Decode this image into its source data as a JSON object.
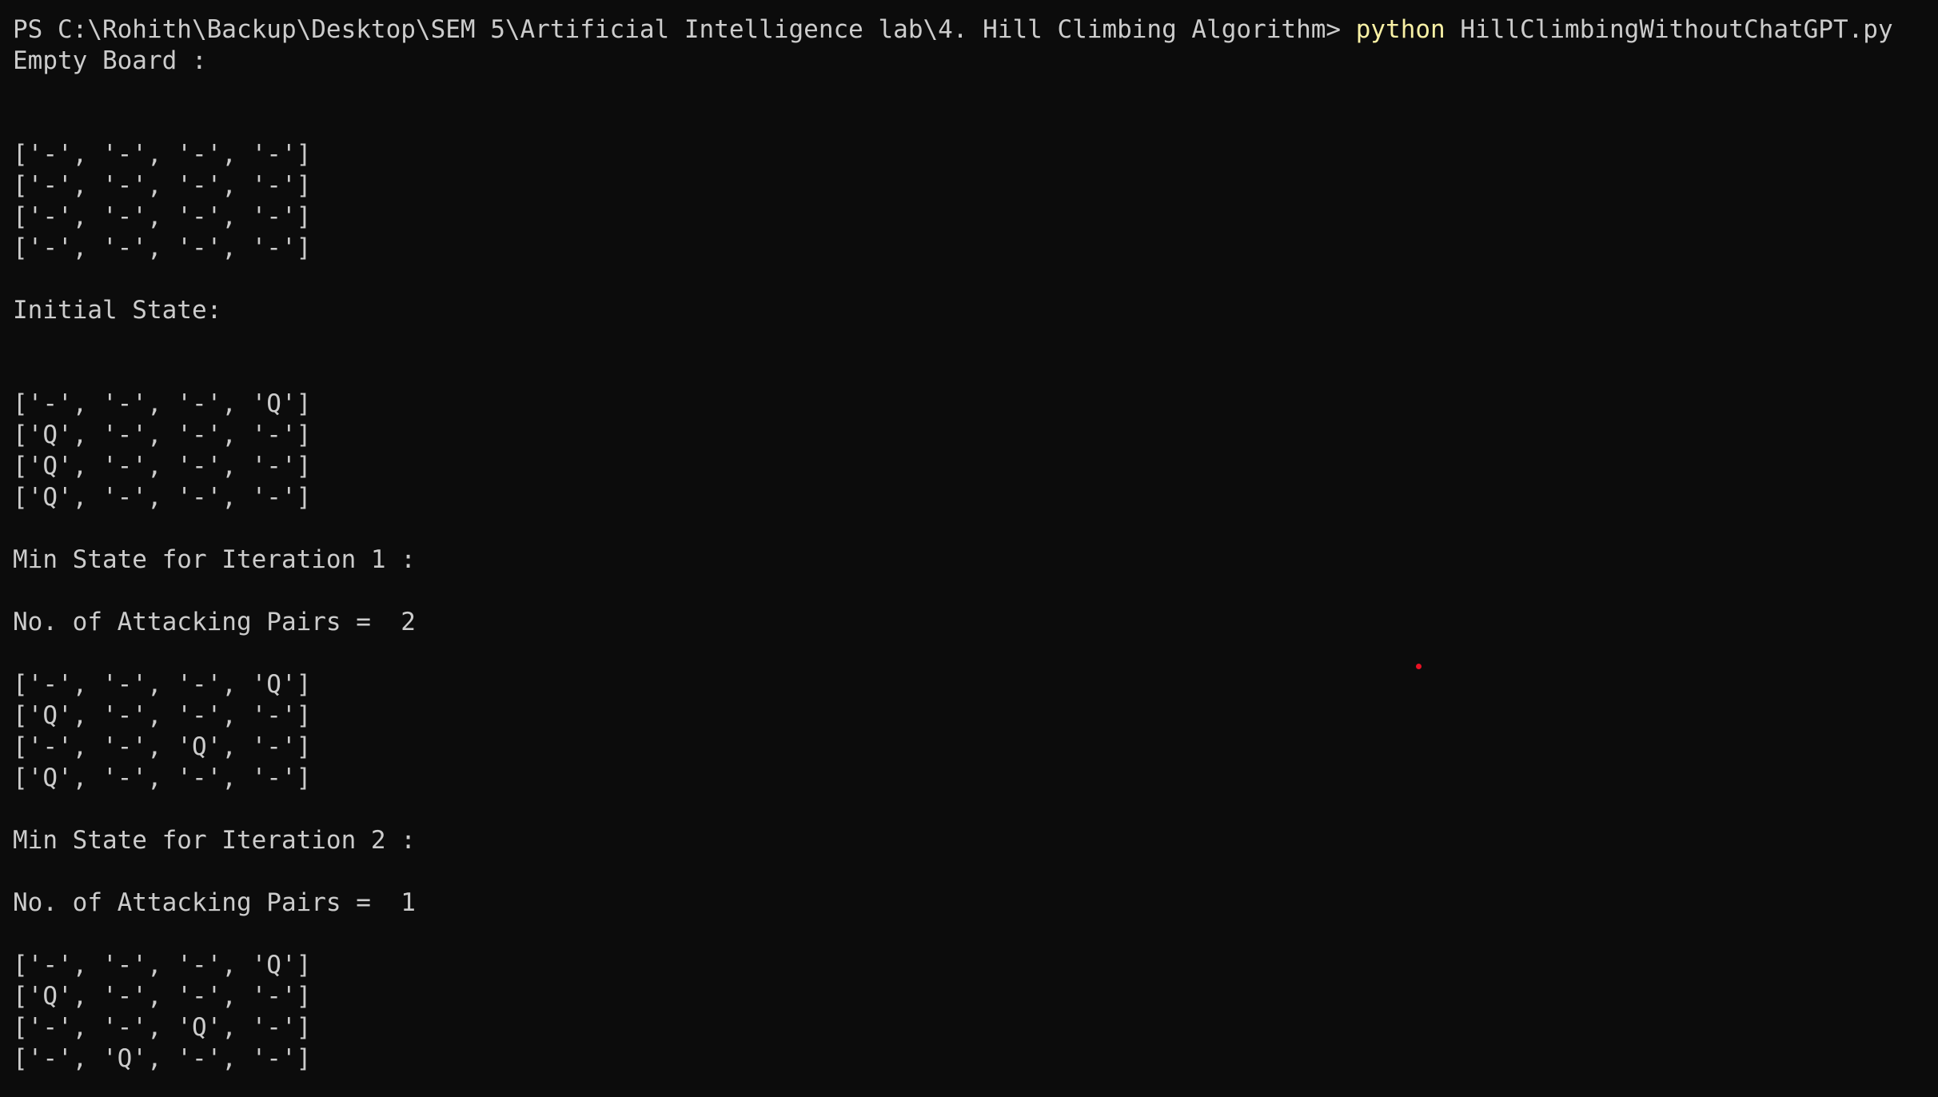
{
  "terminal": {
    "prompt": "PS C:\\Rohith\\Backup\\Desktop\\SEM 5\\Artificial Intelligence lab\\4. Hill Climbing Algorithm> ",
    "command_keyword": "python",
    "command_args": " HillClimbingWithoutChatGPT.py",
    "lines": [
      "Empty Board :",
      "",
      "",
      "['-', '-', '-', '-']",
      "['-', '-', '-', '-']",
      "['-', '-', '-', '-']",
      "['-', '-', '-', '-']",
      "",
      "Initial State:",
      "",
      "",
      "['-', '-', '-', 'Q']",
      "['Q', '-', '-', '-']",
      "['Q', '-', '-', '-']",
      "['Q', '-', '-', '-']",
      "",
      "Min State for Iteration 1 :",
      "",
      "No. of Attacking Pairs =  2",
      "",
      "['-', '-', '-', 'Q']",
      "['Q', '-', '-', '-']",
      "['-', '-', 'Q', '-']",
      "['Q', '-', '-', '-']",
      "",
      "Min State for Iteration 2 :",
      "",
      "No. of Attacking Pairs =  1",
      "",
      "['-', '-', '-', 'Q']",
      "['Q', '-', '-', '-']",
      "['-', '-', 'Q', '-']",
      "['-', 'Q', '-', '-']"
    ]
  },
  "colors": {
    "background": "#0c0c0c",
    "text": "#cccccc",
    "keyword": "#f9f1a5",
    "cursor_dot": "#e81123"
  }
}
